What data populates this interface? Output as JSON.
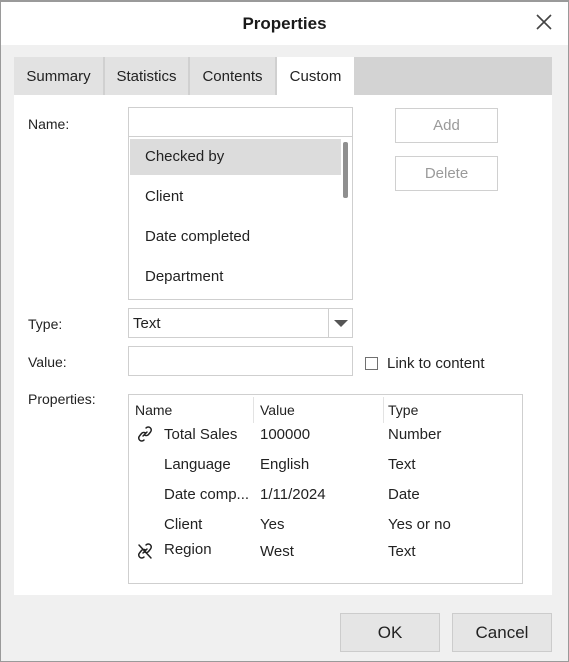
{
  "dialog": {
    "title": "Properties",
    "close_icon": "close-icon"
  },
  "tabs": [
    {
      "label": "Summary",
      "active": false
    },
    {
      "label": "Statistics",
      "active": false
    },
    {
      "label": "Contents",
      "active": false
    },
    {
      "label": "Custom",
      "active": true
    }
  ],
  "form": {
    "name_label": "Name:",
    "name_value": "",
    "name_options": [
      "Checked by",
      "Client",
      "Date completed",
      "Department"
    ],
    "name_selected": "Checked by",
    "add_label": "Add",
    "delete_label": "Delete",
    "type_label": "Type:",
    "type_value": "Text",
    "value_label": "Value:",
    "value_value": "",
    "link_to_content_label": "Link to content",
    "link_to_content_checked": false,
    "properties_label": "Properties:"
  },
  "properties_table": {
    "columns": [
      "Name",
      "Value",
      "Type"
    ],
    "rows": [
      {
        "icon": "link-icon",
        "name": "Total Sales",
        "value": "100000",
        "type": "Number"
      },
      {
        "icon": "",
        "name": "Language",
        "value": "English",
        "type": "Text"
      },
      {
        "icon": "",
        "name": "Date comp...",
        "value": "1/11/2024",
        "type": "Date"
      },
      {
        "icon": "",
        "name": "Client",
        "value": "Yes",
        "type": "Yes or no"
      },
      {
        "icon": "broken-link-icon",
        "name": "Region",
        "value": "West",
        "type": "Text"
      }
    ]
  },
  "footer": {
    "ok_label": "OK",
    "cancel_label": "Cancel"
  }
}
